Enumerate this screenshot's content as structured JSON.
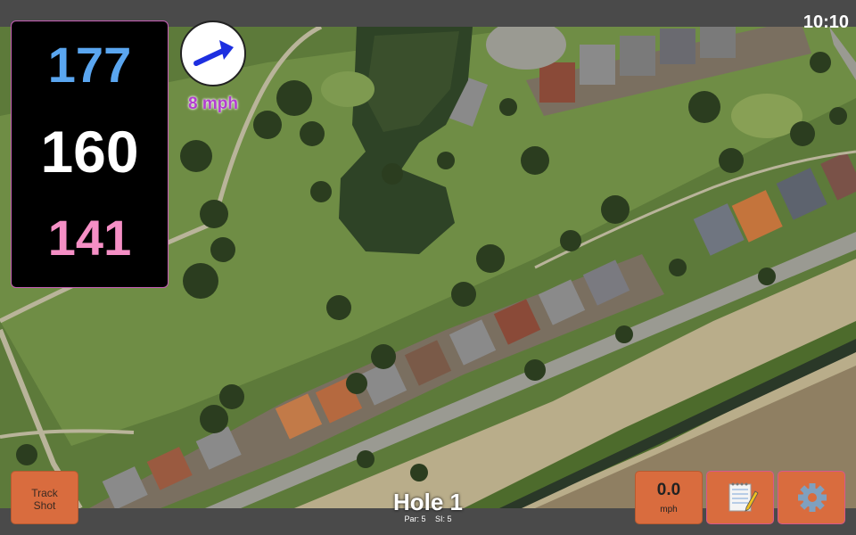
{
  "status": {
    "time": "10:10"
  },
  "distances": {
    "back": "177",
    "middle": "160",
    "front": "141"
  },
  "wind": {
    "speed": "8 mph",
    "direction_icon": "arrow-icon"
  },
  "buttons": {
    "track_shot_line1": "Track",
    "track_shot_line2": "Shot",
    "speed_value": "0.0",
    "speed_unit": "mph",
    "notes_icon": "notepad-icon",
    "settings_icon": "gear-icon"
  },
  "hole": {
    "title": "Hole 1",
    "par": "Par: 5",
    "si": "SI: 5"
  },
  "colors": {
    "back": "#5aa6f0",
    "middle": "#ffffff",
    "front": "#f58fc5",
    "button": "#d96c3e",
    "wind": "#b23ed0"
  }
}
